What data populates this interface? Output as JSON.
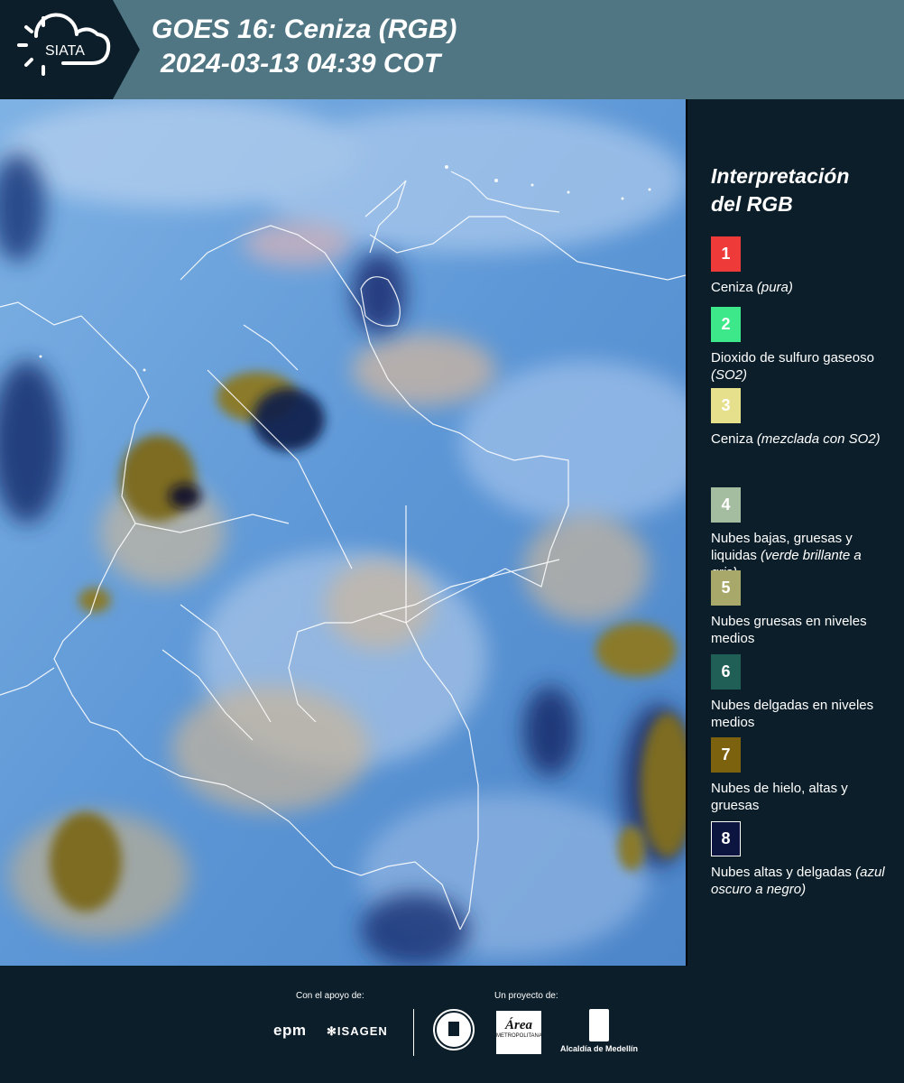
{
  "header": {
    "logo_text": "SIATA",
    "title_line1": "GOES 16: Ceniza (RGB)",
    "title_line2": "2024-03-13 04:39 COT"
  },
  "legend": {
    "title_line1": "Interpretación",
    "title_line2": "del RGB",
    "items": [
      {
        "number": "1",
        "color": "#ef3a3a",
        "text": "Ceniza",
        "text_em": "(pura)"
      },
      {
        "number": "2",
        "color": "#3de88a",
        "text": "Dioxido de sulfuro gaseoso",
        "text_em": "(SO2)"
      },
      {
        "number": "3",
        "color": "#e6e08c",
        "text": "Ceniza",
        "text_em": "(mezclada con SO2)"
      },
      {
        "number": "4",
        "color": "#a4bca0",
        "text": "Nubes bajas, gruesas y liquidas",
        "text_em": "(verde brillante a gris)"
      },
      {
        "number": "5",
        "color": "#a8a86a",
        "text": "Nubes gruesas en niveles medios",
        "text_em": ""
      },
      {
        "number": "6",
        "color": "#1f5f55",
        "text": "Nubes delgadas en niveles medios",
        "text_em": ""
      },
      {
        "number": "7",
        "color": "#7c620e",
        "text": "Nubes de hielo, altas y gruesas",
        "text_em": ""
      },
      {
        "number": "8",
        "color": "#0c1440",
        "text": "Nubes altas y delgadas",
        "text_em": "(azul oscuro a negro)"
      }
    ]
  },
  "footer": {
    "support_label": "Con el apoyo de:",
    "project_label": "Un proyecto de:",
    "sponsor1": "epm",
    "sponsor2": "ISAGEN",
    "partner_area": "Área",
    "partner_area_sub": "METROPOLITANA",
    "partner_medellin": "Alcaldía de Medellín"
  }
}
